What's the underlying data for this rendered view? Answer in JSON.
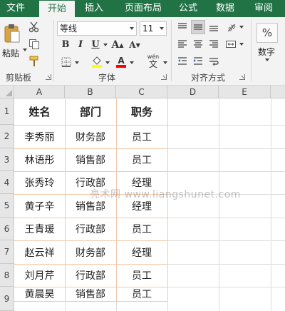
{
  "ribbon": {
    "tabs": [
      "文件",
      "开始",
      "插入",
      "页面布局",
      "公式",
      "数据",
      "审阅"
    ],
    "active_tab": "开始",
    "clipboard": {
      "paste_label": "粘贴",
      "group_label": "剪贴板"
    },
    "font": {
      "font_name": "等线",
      "font_size": "11",
      "wen_label": "wén",
      "wen_char": "文",
      "group_label": "字体"
    },
    "alignment": {
      "group_label": "对齐方式"
    },
    "number": {
      "label": "数字",
      "percent": "%"
    },
    "colors": {
      "accent": "#217346",
      "highlight": "#ffff00",
      "font_color": "#ff0000"
    }
  },
  "sheet": {
    "columns": [
      "A",
      "B",
      "C",
      "D",
      "E"
    ],
    "rows": [
      "1",
      "2",
      "3",
      "4",
      "5",
      "6",
      "7",
      "8",
      "9"
    ],
    "table": {
      "headers": [
        "姓名",
        "部门",
        "职务"
      ],
      "data": [
        [
          "李秀丽",
          "财务部",
          "员工"
        ],
        [
          "林语彤",
          "销售部",
          "员工"
        ],
        [
          "张秀玲",
          "行政部",
          "经理"
        ],
        [
          "黄子辛",
          "销售部",
          "经理"
        ],
        [
          "王青瑗",
          "行政部",
          "员工"
        ],
        [
          "赵云祥",
          "财务部",
          "经理"
        ],
        [
          "刘月芹",
          "行政部",
          "员工"
        ],
        [
          "黄晨昊",
          "销售部",
          "员工"
        ]
      ]
    },
    "watermark": "亮术网 www.liangshunet.com"
  }
}
